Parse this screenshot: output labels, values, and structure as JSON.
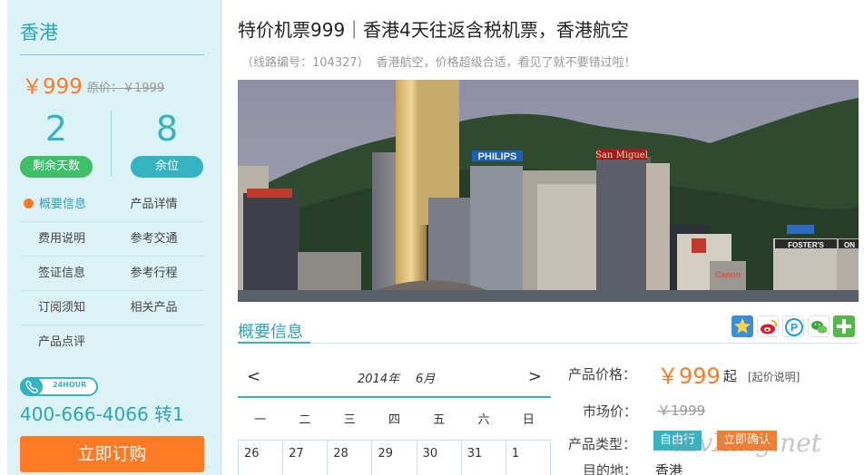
{
  "sidebar": {
    "destination": "香港",
    "price": "￥999",
    "original_price": "原价：￥1999",
    "days_left": "2",
    "days_left_label": "剩余天数",
    "seats_left": "8",
    "seats_left_label": "余位",
    "nav": [
      [
        "概要信息",
        "产品详情"
      ],
      [
        "费用说明",
        "参考交通"
      ],
      [
        "签证信息",
        "参考行程"
      ],
      [
        "订阅须知",
        "相关产品"
      ],
      [
        "产品点评",
        ""
      ]
    ],
    "hour_badge": "24HOUR",
    "hotline": "400-666-4066 转1",
    "order_button": "立即订购"
  },
  "product": {
    "title": "特价机票999｜香港4天往返含税机票，香港航空",
    "route_code": "（线路编号：104327）",
    "subtitle": "香港航空，价格超级合适，看见了就不要错过啦！",
    "hero_signs": [
      "PHILIPS",
      "San Miguel",
      "FOSTER'S",
      "Canon",
      "ON"
    ]
  },
  "section": {
    "title": "概要信息"
  },
  "calendar": {
    "prev": "<",
    "next": ">",
    "year": "2014年",
    "month": "6月",
    "weekdays": [
      "一",
      "二",
      "三",
      "四",
      "五",
      "六",
      "日"
    ],
    "first_row": [
      "26",
      "27",
      "28",
      "29",
      "30",
      "31",
      "1"
    ]
  },
  "info": {
    "price_label": "产品价格：",
    "price": "￥999",
    "price_suffix": "起",
    "price_note": "[起价说明]",
    "market_label": "市场价：",
    "market_price": "￥1999",
    "type_label": "产品类型：",
    "tags": [
      "自由行",
      "立即确认"
    ],
    "dest_label": "目的地：",
    "dest": "香港"
  },
  "watermark": "iLvXing.net",
  "share_icons": [
    "qzone-star-icon",
    "weibo-icon",
    "tencent-weibo-icon",
    "wechat-icon",
    "more-plus-icon"
  ],
  "colors": {
    "accent": "#2aa6b4",
    "orange": "#ff7a25",
    "green_badge": "#3fbf6a",
    "sidebar_bg": "#dbf2f6"
  }
}
